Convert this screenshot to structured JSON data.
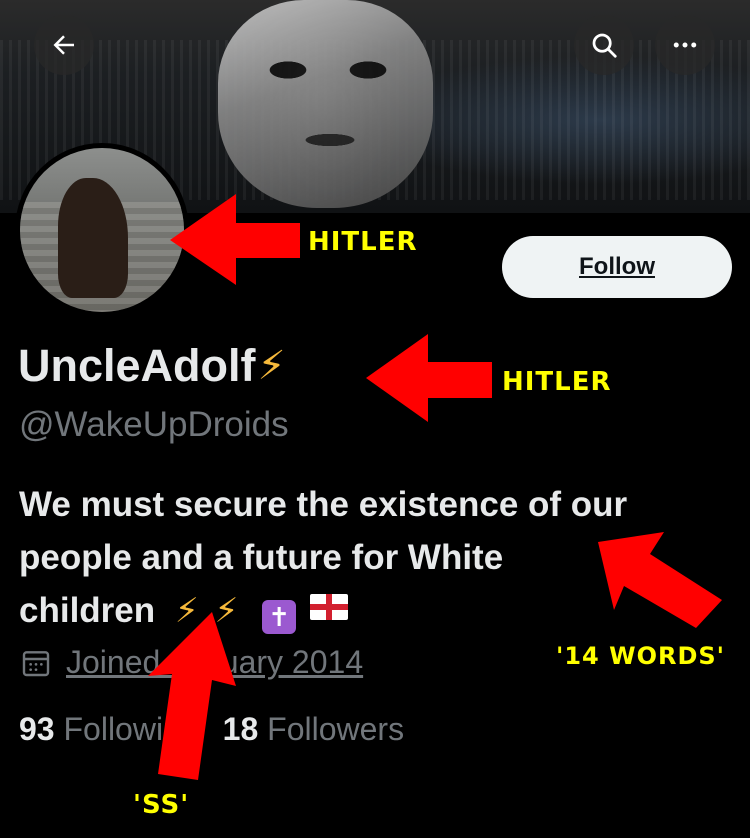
{
  "profile": {
    "display_name": "UncleAdolf",
    "handle": "@WakeUpDroids",
    "bio_lines": [
      "We must secure the existence of our",
      "people and a future for White",
      "children"
    ],
    "joined": "Joined January 2014",
    "following_count": "93",
    "following_label": "Following",
    "followers_count": "18",
    "followers_label": "Followers"
  },
  "header": {
    "back_icon": "arrow-left-icon",
    "search_icon": "search-icon",
    "more_icon": "more-icon"
  },
  "actions": {
    "follow_label": "Follow"
  },
  "annotations": {
    "avatar_label": "HITLER",
    "name_label": "HITLER",
    "bio_label": "'14 WORDS'",
    "emoji_label": "'SS'"
  },
  "colors": {
    "background": "#000000",
    "text_primary": "#e7e9ea",
    "text_secondary": "#71767b",
    "arrow": "#ff0000",
    "annotation_text": "#ffff00",
    "bolt": "#f6b93b"
  }
}
